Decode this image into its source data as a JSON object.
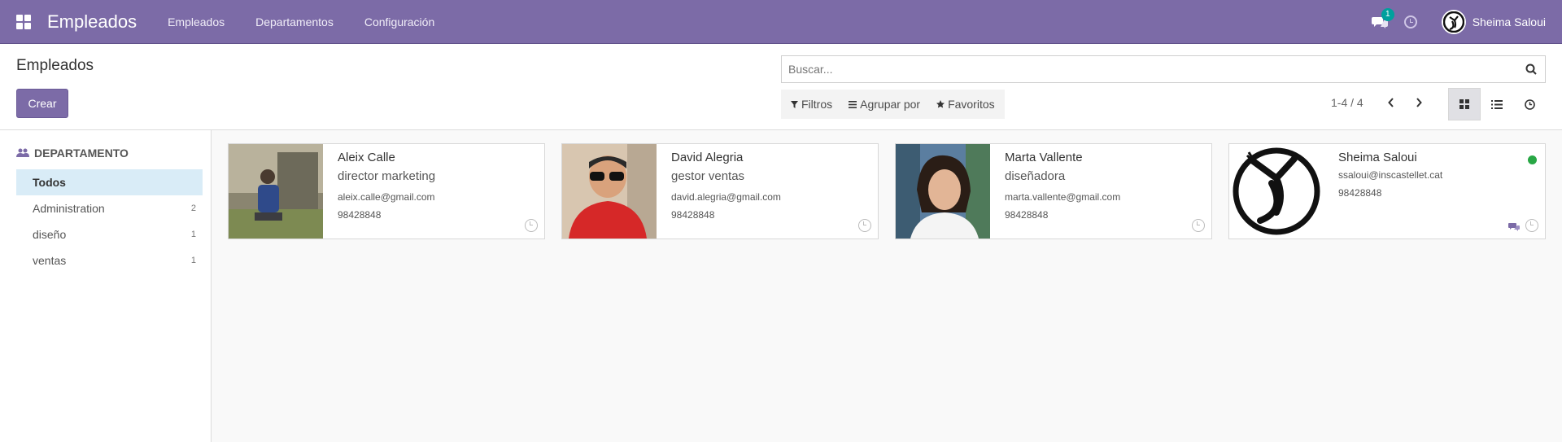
{
  "navbar": {
    "app_name": "Empleados",
    "menu": [
      "Empleados",
      "Departamentos",
      "Configuración"
    ],
    "notification_count": "1",
    "user_name": "Sheima Saloui"
  },
  "control": {
    "title": "Empleados",
    "create_label": "Crear",
    "search_placeholder": "Buscar...",
    "filters_label": "Filtros",
    "group_label": "Agrupar por",
    "favorites_label": "Favoritos",
    "pager": "1-4 / 4"
  },
  "sidebar": {
    "heading": "DEPARTAMENTO",
    "items": [
      {
        "label": "Todos",
        "count": ""
      },
      {
        "label": "Administration",
        "count": "2"
      },
      {
        "label": "diseño",
        "count": "1"
      },
      {
        "label": "ventas",
        "count": "1"
      }
    ]
  },
  "employees": [
    {
      "name": "Aleix Calle",
      "job": "director marketing",
      "email": "aleix.calle@gmail.com",
      "phone": "98428848"
    },
    {
      "name": "David Alegria",
      "job": "gestor ventas",
      "email": "david.alegria@gmail.com",
      "phone": "98428848"
    },
    {
      "name": "Marta Vallente",
      "job": "diseñadora",
      "email": "marta.vallente@gmail.com",
      "phone": "98428848"
    },
    {
      "name": "Sheima Saloui",
      "job": "",
      "email": "ssaloui@inscastellet.cat",
      "phone": "98428848"
    }
  ],
  "colors": {
    "brand": "#7c6ba7",
    "online": "#28a745",
    "badge": "#00a09d",
    "selected": "#d9ecf7"
  }
}
